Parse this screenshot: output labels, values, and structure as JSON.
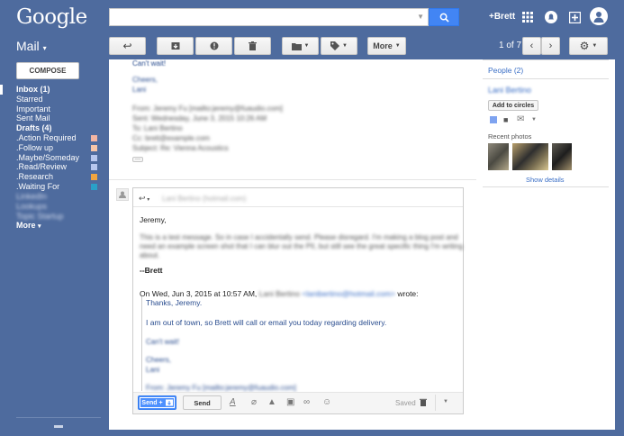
{
  "app": {
    "logo": "Google"
  },
  "header": {
    "user": "+Brett"
  },
  "toolbar": {
    "mail_menu": "Mail",
    "more_label": "More",
    "page_count": "1 of 7"
  },
  "sidebar": {
    "compose_label": "COMPOSE",
    "items": [
      {
        "label": "Inbox (1)"
      },
      {
        "label": "Starred"
      },
      {
        "label": "Important"
      },
      {
        "label": "Sent Mail"
      },
      {
        "label": "Drafts (4)"
      },
      {
        "label": ".Action Required"
      },
      {
        "label": ".Follow up"
      },
      {
        "label": ".Maybe/Someday"
      },
      {
        "label": ".Read/Review"
      },
      {
        "label": ".Research"
      },
      {
        "label": ".Waiting For"
      },
      {
        "label": "LinkedIn"
      },
      {
        "label": "Lookups"
      },
      {
        "label": "Topic Startup"
      },
      {
        "label": "More"
      }
    ],
    "label_colors": [
      "#f2b5a3",
      "#f7c6a9",
      "#b7c7ee",
      "#b7c7ee",
      "#f0a540",
      "#2aa0c8"
    ]
  },
  "message": {
    "top_line": "Can't wait!",
    "sig": [
      "Cheers,",
      "Lani"
    ]
  },
  "reply": {
    "greeting": "Jeremy,",
    "signoff": "--Brett",
    "quote_header": "On Wed, Jun 3, 2015 at 10:57 AM,",
    "quote_wrote": "wrote:",
    "quote_thanks": "Thanks, Jeremy.",
    "quote_body": "I am out of town, so Brett will call or email you today regarding delivery.",
    "send_plus": "Send +",
    "send": "Send",
    "saved": "Saved"
  },
  "right_panel": {
    "people": "People (2)",
    "add_circles": "Add to circles",
    "recent_photos": "Recent photos",
    "show_details": "Show details"
  }
}
